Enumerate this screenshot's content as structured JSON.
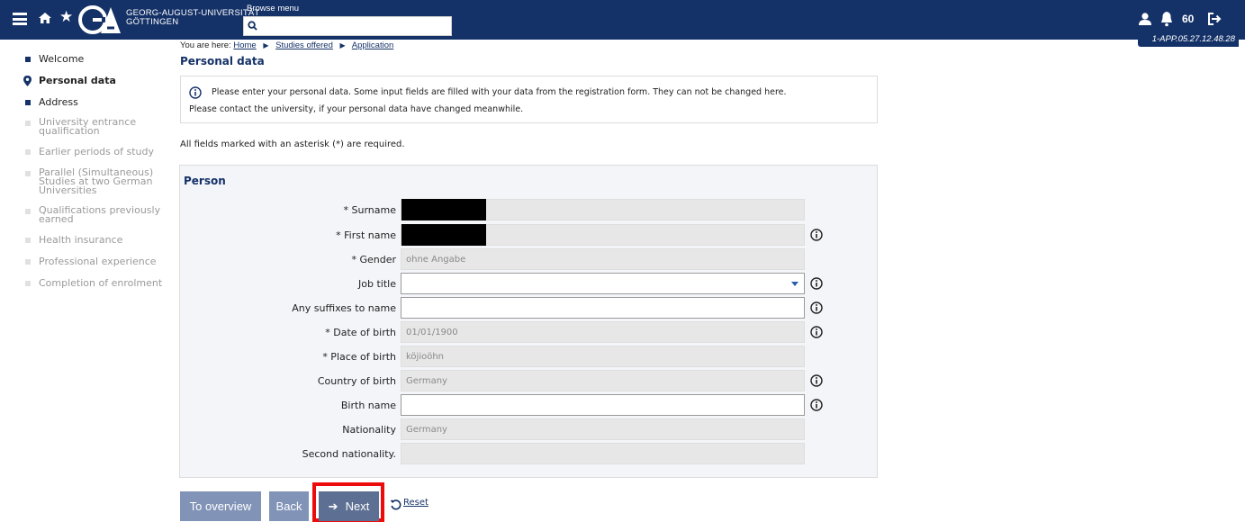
{
  "header": {
    "logo_line1": "GEORG-AUGUST-UNIVERSITÄT",
    "logo_line2": "GÖTTINGEN",
    "browse_menu_label": "Browse menu",
    "search_value": "",
    "session_counter": "60",
    "version": "1-APP.05.27.12.48.28"
  },
  "breadcrumb": {
    "prefix": "You are here:",
    "items": [
      "Home",
      "Studies offered",
      "Application"
    ]
  },
  "page_title": "Personal data",
  "sidebar": {
    "items": [
      {
        "label": "Welcome",
        "state": "done"
      },
      {
        "label": "Personal data",
        "state": "active"
      },
      {
        "label": "Address",
        "state": "done"
      },
      {
        "label": "University entrance qualification",
        "state": "todo"
      },
      {
        "label": "Earlier periods of study",
        "state": "todo"
      },
      {
        "label": "Parallel (Simultaneous) Studies at two German Universities",
        "state": "todo"
      },
      {
        "label": "Qualifications previously earned",
        "state": "todo"
      },
      {
        "label": "Health insurance",
        "state": "todo"
      },
      {
        "label": "Professional experience",
        "state": "todo"
      },
      {
        "label": "Completion of enrolment",
        "state": "todo"
      }
    ]
  },
  "info": {
    "line1": "Please enter your personal data. Some input fields are filled with your data from the registration form. They can not be changed here.",
    "line2": "Please contact the university, if your personal data have changed meanwhile."
  },
  "required_note": "All fields marked with an asterisk (*) are required.",
  "form": {
    "title": "Person",
    "fields": {
      "surname": {
        "label": "* Surname",
        "value": ""
      },
      "first_name": {
        "label": "* First name",
        "value": ""
      },
      "gender": {
        "label": "* Gender",
        "value": "ohne Angabe"
      },
      "job_title": {
        "label": "Job title",
        "value": ""
      },
      "suffixes": {
        "label": "Any suffixes to name",
        "value": ""
      },
      "date_of_birth": {
        "label": "* Date of birth",
        "value": "01/01/1900"
      },
      "place_of_birth": {
        "label": "* Place of birth",
        "value": "köjioöhn"
      },
      "country_of_birth": {
        "label": "Country of birth",
        "value": "Germany"
      },
      "birth_name": {
        "label": "Birth name",
        "value": ""
      },
      "nationality": {
        "label": "Nationality",
        "value": "Germany"
      },
      "second_nationality": {
        "label": "Second nationality.",
        "value": ""
      }
    }
  },
  "buttons": {
    "overview": "To overview",
    "back": "Back",
    "next": "Next",
    "reset": "Reset"
  },
  "colors": {
    "header_bg": "#153268",
    "button_bg": "#8193b7",
    "highlight_frame": "#ec0c0c"
  }
}
